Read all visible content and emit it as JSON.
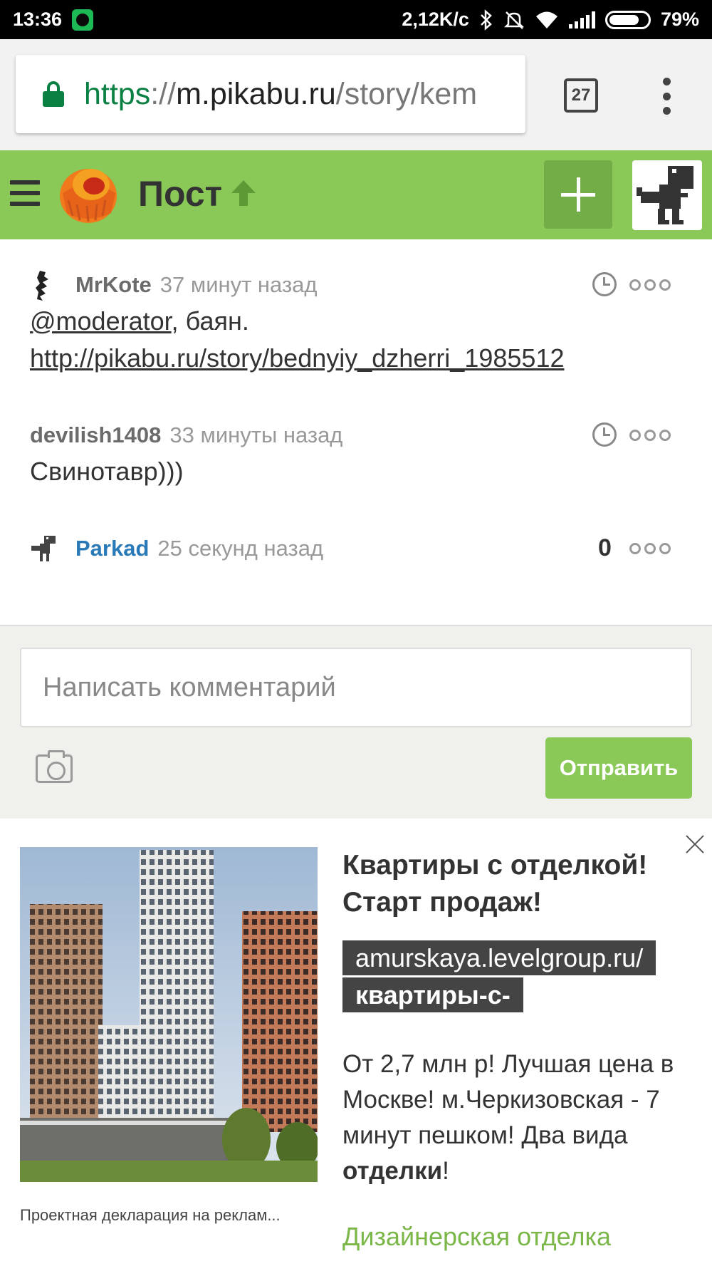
{
  "status_bar": {
    "time": "13:36",
    "network_speed": "2,12K/c",
    "battery": "79%",
    "battery_level": 0.79,
    "icons": [
      "spotify-icon",
      "bluetooth-icon",
      "silent-icon",
      "wifi-icon",
      "signal-icon",
      "battery-icon"
    ]
  },
  "browser": {
    "url_scheme": "https",
    "url_sep": "://",
    "url_host": "m.pikabu.ru",
    "url_path": "/story/kem",
    "tab_count": "27"
  },
  "header": {
    "title": "Пост",
    "accent": "#8ac858",
    "add_button_color": "#72ad47"
  },
  "comments": [
    {
      "user": "MrKote",
      "time": "37 минут назад",
      "mention": "@moderator",
      "text_rest": ", баян.",
      "link": "http://pikabu.ru/story/bednyiy_dzherri_1985512"
    },
    {
      "user": "devilish1408",
      "time": "33 минуты назад",
      "text": "Свинотавр)))"
    },
    {
      "user": "Parkad",
      "time": "25 секунд назад",
      "rating": "0"
    }
  ],
  "comment_form": {
    "placeholder": "Написать комментарий",
    "send_label": "Отправить"
  },
  "ad": {
    "title": "Квартиры с отделкой! Старт продаж!",
    "domain_line1": "amurskaya.levelgroup.ru/",
    "domain_line2": "квартиры-с-",
    "text_before": "От 2,7 млн р! Лучшая цена в Москве! м.Черкизовская - 7 минут пешком! Два вида ",
    "text_bold": "отделки",
    "text_after": "!",
    "link": "Дизайнерская отделка",
    "declaration": "Проектная декларация на реклам..."
  }
}
